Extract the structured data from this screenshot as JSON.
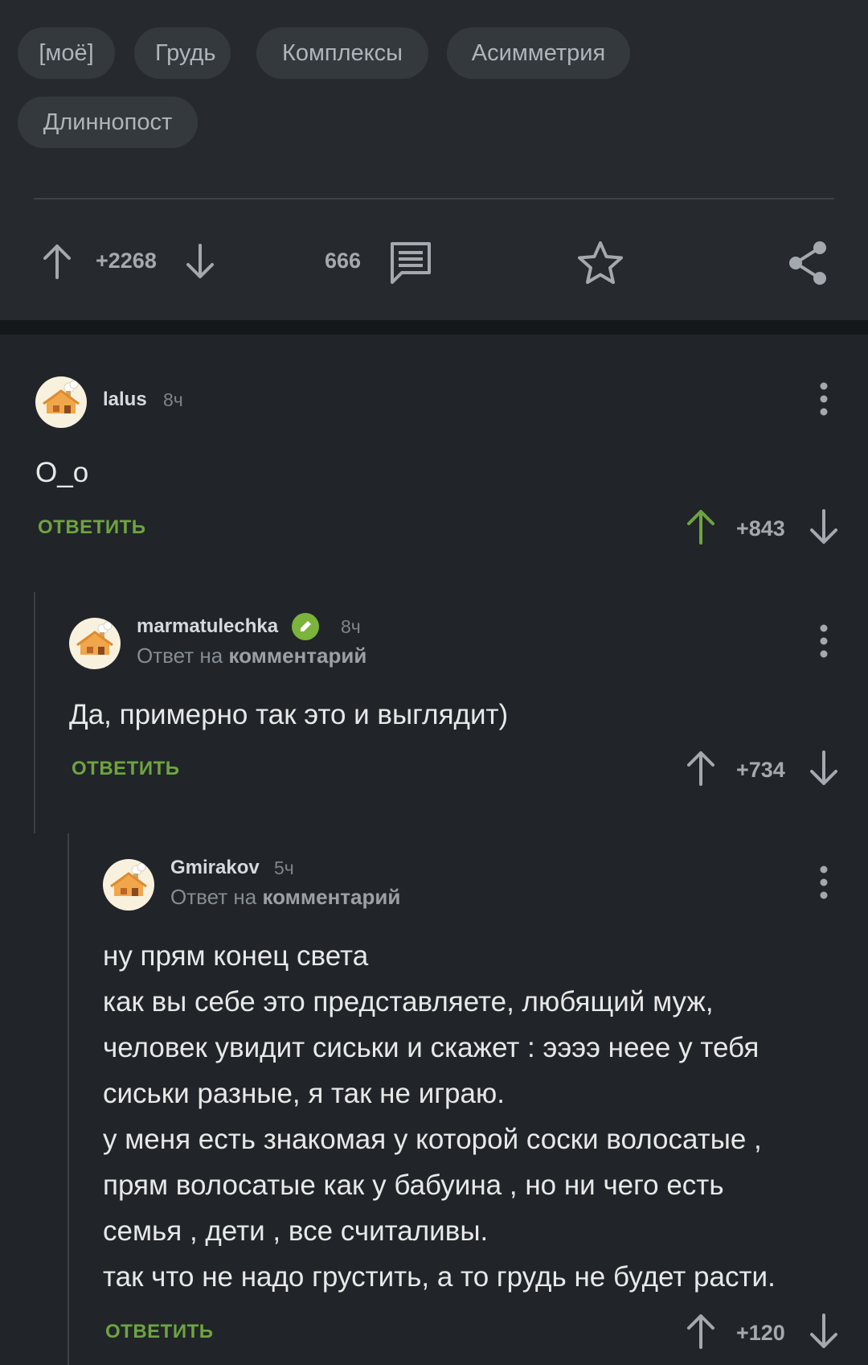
{
  "tags": [
    "[моё]",
    "Грудь",
    "Комплексы",
    "Асимметрия",
    "Длиннопост"
  ],
  "post": {
    "rating": "+2268",
    "comments_count": "666"
  },
  "comments": [
    {
      "user": "lalus",
      "time": "8ч",
      "reply_to": null,
      "lines": [
        "O_o"
      ],
      "reply_label": "ОТВЕТИТЬ",
      "score": "+843"
    },
    {
      "user": "marmatulechka",
      "time": "8ч",
      "reply_prefix": "Ответ на ",
      "reply_target": "комментарий",
      "lines": [
        "Да, примерно так это и выглядит)"
      ],
      "reply_label": "ОТВЕТИТЬ",
      "score": "+734"
    },
    {
      "user": "Gmirakov",
      "time": "5ч",
      "reply_prefix": "Ответ на ",
      "reply_target": "комментарий",
      "lines": [
        "ну прям конец света",
        "как вы себе это представляете, любящий муж,",
        "человек увидит сиськи и скажет : ээээ неее у тебя",
        "сиськи разные, я так не играю.",
        "у меня есть знакомая у которой соски волосатые ,",
        "прям волосатые как у бабуина , но ни чего есть",
        "семья , дети , все считаливы.",
        "так что не надо грустить, а то грудь не будет расти."
      ],
      "reply_label": "ОТВЕТИТЬ",
      "score": "+120"
    }
  ],
  "colors": {
    "accent_green": "#6ea43f",
    "background": "#212529",
    "post_background": "#262a2e"
  },
  "icons": [
    "arrow-up-icon",
    "arrow-down-icon",
    "comment-icon",
    "star-icon",
    "share-icon",
    "more-vertical-icon",
    "pencil-icon"
  ]
}
